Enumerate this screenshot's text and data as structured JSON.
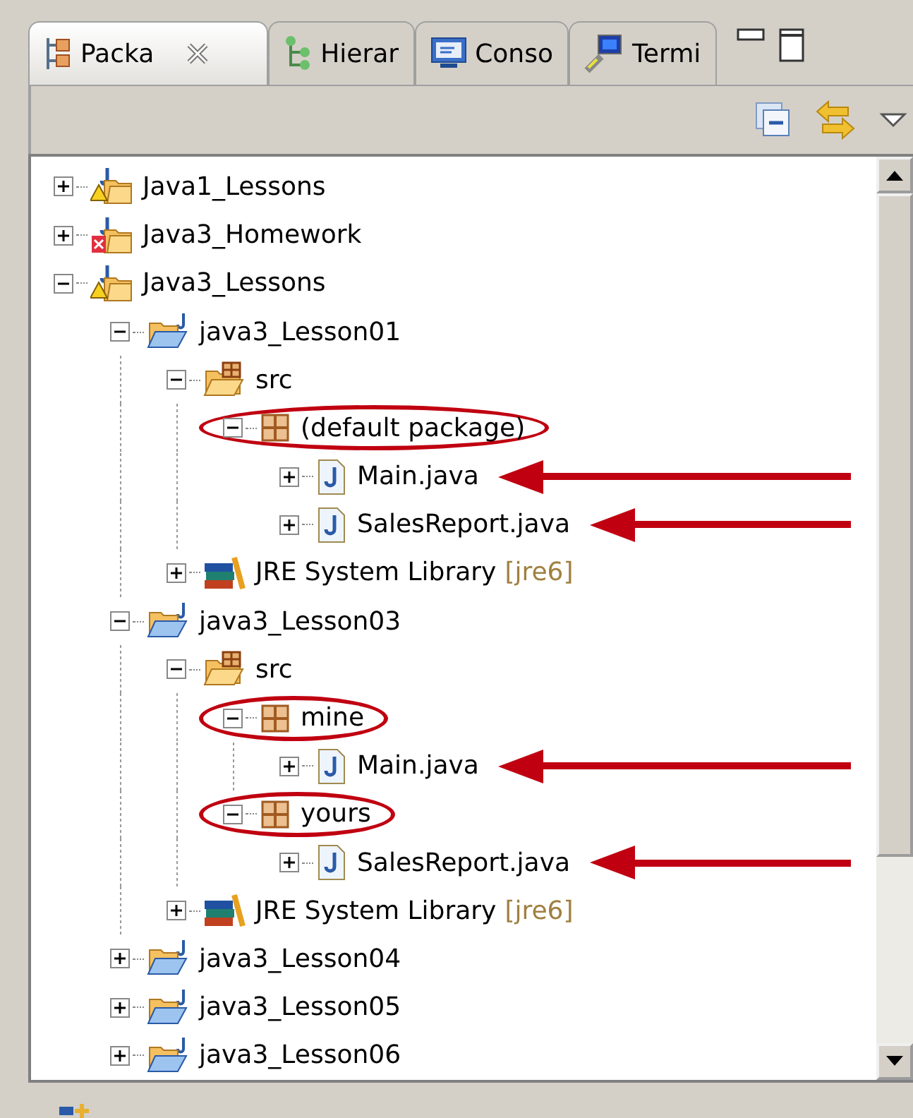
{
  "tabs": [
    {
      "label": "Packa",
      "selected": true
    },
    {
      "label": "Hierar",
      "selected": false
    },
    {
      "label": "Conso",
      "selected": false
    },
    {
      "label": "Termi",
      "selected": false
    }
  ],
  "tree": [
    {
      "label": "Java1_Lessons",
      "kind": "project",
      "warning": true,
      "error": false,
      "expanded": false,
      "circled": false,
      "arrowed": false
    },
    {
      "label": "Java3_Homework",
      "kind": "project",
      "warning": false,
      "error": true,
      "expanded": false,
      "circled": false,
      "arrowed": false
    },
    {
      "label": "Java3_Lessons",
      "kind": "project",
      "warning": true,
      "error": false,
      "expanded": true,
      "circled": false,
      "arrowed": false,
      "children": [
        {
          "label": "java3_Lesson01",
          "kind": "folder",
          "expanded": true,
          "circled": false,
          "arrowed": false,
          "children": [
            {
              "label": "src",
              "kind": "source",
              "expanded": true,
              "circled": false,
              "arrowed": false,
              "children": [
                {
                  "label": "(default package)",
                  "kind": "package",
                  "expanded": true,
                  "circled": true,
                  "arrowed": false,
                  "children": [
                    {
                      "label": "Main.java",
                      "kind": "java",
                      "expanded": false,
                      "circled": false,
                      "arrowed": true
                    },
                    {
                      "label": "SalesReport.java",
                      "kind": "java",
                      "expanded": false,
                      "circled": false,
                      "arrowed": true
                    }
                  ]
                }
              ]
            },
            {
              "label": "JRE System Library",
              "decoration": "[jre6]",
              "kind": "library",
              "expanded": false,
              "circled": false,
              "arrowed": false
            }
          ]
        },
        {
          "label": "java3_Lesson03",
          "kind": "folder",
          "expanded": true,
          "circled": false,
          "arrowed": false,
          "children": [
            {
              "label": "src",
              "kind": "source",
              "expanded": true,
              "circled": false,
              "arrowed": false,
              "children": [
                {
                  "label": "mine",
                  "kind": "package",
                  "expanded": true,
                  "circled": true,
                  "arrowed": false,
                  "children": [
                    {
                      "label": "Main.java",
                      "kind": "java",
                      "expanded": false,
                      "circled": false,
                      "arrowed": true
                    }
                  ]
                },
                {
                  "label": "yours",
                  "kind": "package",
                  "expanded": true,
                  "circled": true,
                  "arrowed": false,
                  "children": [
                    {
                      "label": "SalesReport.java",
                      "kind": "java",
                      "expanded": false,
                      "circled": false,
                      "arrowed": true
                    }
                  ]
                }
              ]
            },
            {
              "label": "JRE System Library",
              "decoration": "[jre6]",
              "kind": "library",
              "expanded": false,
              "circled": false,
              "arrowed": false
            }
          ]
        },
        {
          "label": "java3_Lesson04",
          "kind": "folder",
          "expanded": false,
          "circled": false,
          "arrowed": false
        },
        {
          "label": "java3_Lesson05",
          "kind": "folder",
          "expanded": false,
          "circled": false,
          "arrowed": false
        },
        {
          "label": "java3_Lesson06",
          "kind": "folder",
          "expanded": false,
          "circled": false,
          "arrowed": false
        }
      ]
    }
  ]
}
